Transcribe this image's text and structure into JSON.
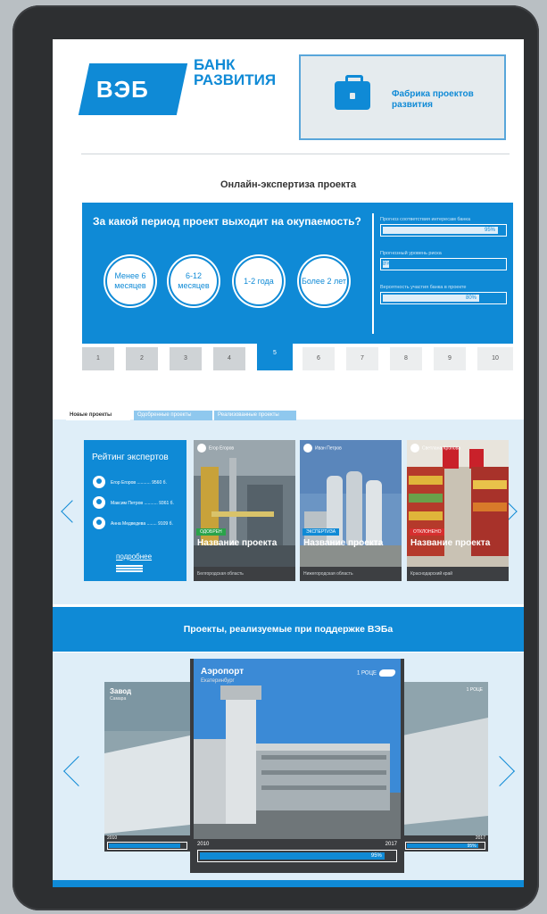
{
  "header": {
    "logo_text": "ВЭБ",
    "bank_name": "БАНК РАЗВИТИЯ",
    "factory": "Фабрика проектов развития"
  },
  "expertise": {
    "title": "Онлайн-экспертиза проекта",
    "question": "За какой период проект выходит на окупаемость?",
    "options": [
      "Менее 6 месяцев",
      "6-12 месяцев",
      "1-2 года",
      "Более 2 лет"
    ],
    "stats": [
      {
        "label": "Прогноз соответствия интересам банка",
        "value": "95%",
        "fraction": 0.95
      },
      {
        "label": "Прогнозный уровень риска",
        "value": "8%",
        "fraction": 0.08
      },
      {
        "label": "Вероятность участия банка в проекте",
        "value": "80%",
        "fraction": 0.8
      }
    ],
    "steps": [
      "1",
      "2",
      "3",
      "4",
      "5",
      "6",
      "7",
      "8",
      "9",
      "10"
    ],
    "active_step": "5"
  },
  "tabs": [
    "Новые проекты",
    "Одобренные проекты",
    "Реализованные проекты"
  ],
  "rating": {
    "title": "Рейтинг экспертов",
    "experts": [
      "Егор Егоров ........... 9560 б.",
      "Максим Петров ........... 9361 б.",
      "Анна Медведева ........ 9109 б."
    ],
    "more": "подробнее"
  },
  "cards": [
    {
      "user": "Егор Егоров",
      "badge": "ОДОБРЕН",
      "badge_color": "#2aa34a",
      "title": "Название проекта",
      "region": "Белгородская область"
    },
    {
      "user": "Иван Петров",
      "badge": "ЭКСПЕРТИЗА",
      "badge_color": "#0f8ad6",
      "title": "Название проекта",
      "region": "Нижегородская область"
    },
    {
      "user": "Светлана Кронова",
      "badge": "ОТКЛОНЕНО",
      "badge_color": "#d62f2f",
      "title": "Название проекта",
      "region": "Краснодарский край"
    }
  ],
  "supported": {
    "title": "Проекты, реализуемые при поддержке ВЭБа",
    "left": {
      "title": "Завод",
      "subtitle": "Самара",
      "year_start": "2010"
    },
    "center": {
      "title": "Аэропорт",
      "subtitle": "Екатеринбург",
      "rating": "1 РОЦЕ",
      "year_start": "2010",
      "year_end": "2017",
      "progress": "95%",
      "fraction": 0.95
    },
    "right": {
      "label": "1 РОЦЕ",
      "year_end": "2017",
      "progress": "95%",
      "fraction": 0.95
    }
  },
  "colors": {
    "accent": "#0f8ad6",
    "light": "#dfeef8"
  }
}
